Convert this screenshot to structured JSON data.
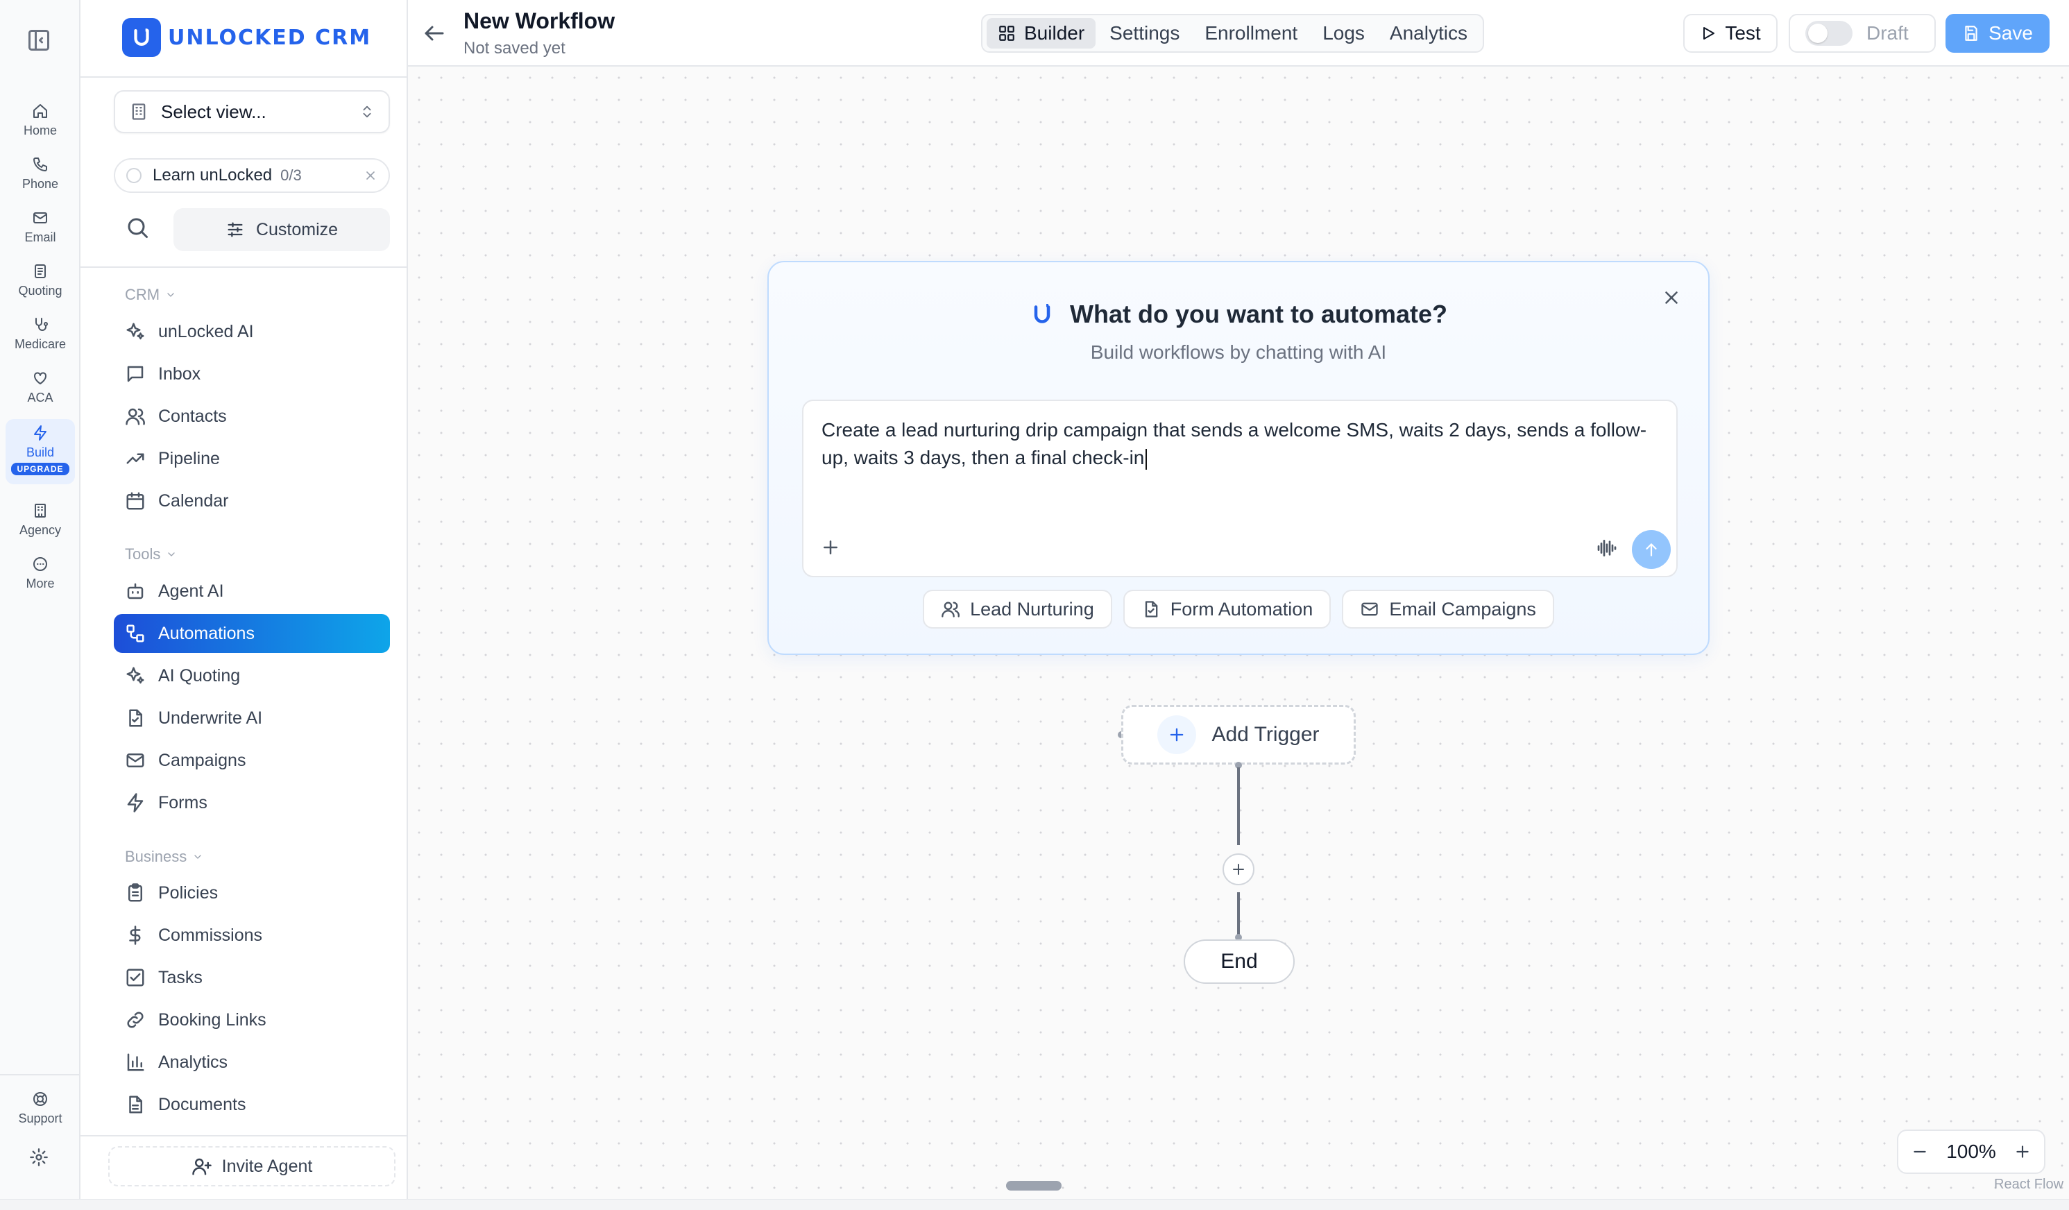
{
  "rail": {
    "items": [
      {
        "label": "Home",
        "icon": "home-icon"
      },
      {
        "label": "Phone",
        "icon": "phone-icon"
      },
      {
        "label": "Email",
        "icon": "email-icon"
      },
      {
        "label": "Quoting",
        "icon": "quoting-icon"
      },
      {
        "label": "Medicare",
        "icon": "stethoscope-icon"
      },
      {
        "label": "ACA",
        "icon": "heart-icon"
      },
      {
        "label": "Build",
        "icon": "bolt-icon",
        "badge": "UPGRADE",
        "active": true
      },
      {
        "label": "Agency",
        "icon": "building-icon"
      },
      {
        "label": "More",
        "icon": "more-icon"
      }
    ],
    "support_label": "Support"
  },
  "sidebar": {
    "logo_text": "UNLOCKED CRM",
    "select_view": "Select view...",
    "learn": {
      "label": "Learn unLocked",
      "progress": "0/3"
    },
    "customize_label": "Customize",
    "sections": {
      "crm": "CRM",
      "tools": "Tools",
      "business": "Business"
    },
    "crm_items": [
      "unLocked AI",
      "Inbox",
      "Contacts",
      "Pipeline",
      "Calendar"
    ],
    "tools_items": [
      "Agent AI",
      "Automations",
      "AI Quoting",
      "Underwrite AI",
      "Campaigns",
      "Forms"
    ],
    "business_items": [
      "Policies",
      "Commissions",
      "Tasks",
      "Booking Links",
      "Analytics",
      "Documents"
    ],
    "active_item": "Automations",
    "invite_label": "Invite Agent"
  },
  "header": {
    "title": "New Workflow",
    "subtitle": "Not saved yet",
    "tabs": [
      "Builder",
      "Settings",
      "Enrollment",
      "Logs",
      "Analytics"
    ],
    "active_tab": "Builder",
    "test_label": "Test",
    "draft_label": "Draft",
    "save_label": "Save"
  },
  "ai_panel": {
    "title": "What do you want to automate?",
    "subtitle": "Build workflows by chatting with AI",
    "prompt_value": "Create a lead nurturing drip campaign that sends a welcome SMS, waits 2 days, sends a follow-up, waits 3 days, then a final check-in",
    "chips": [
      "Lead Nurturing",
      "Form Automation",
      "Email Campaigns"
    ]
  },
  "canvas": {
    "add_trigger_label": "Add Trigger",
    "end_label": "End",
    "zoom": "100%",
    "attribution": "React Flow"
  },
  "colors": {
    "accent": "#2563eb",
    "save": "#60a5fa"
  }
}
